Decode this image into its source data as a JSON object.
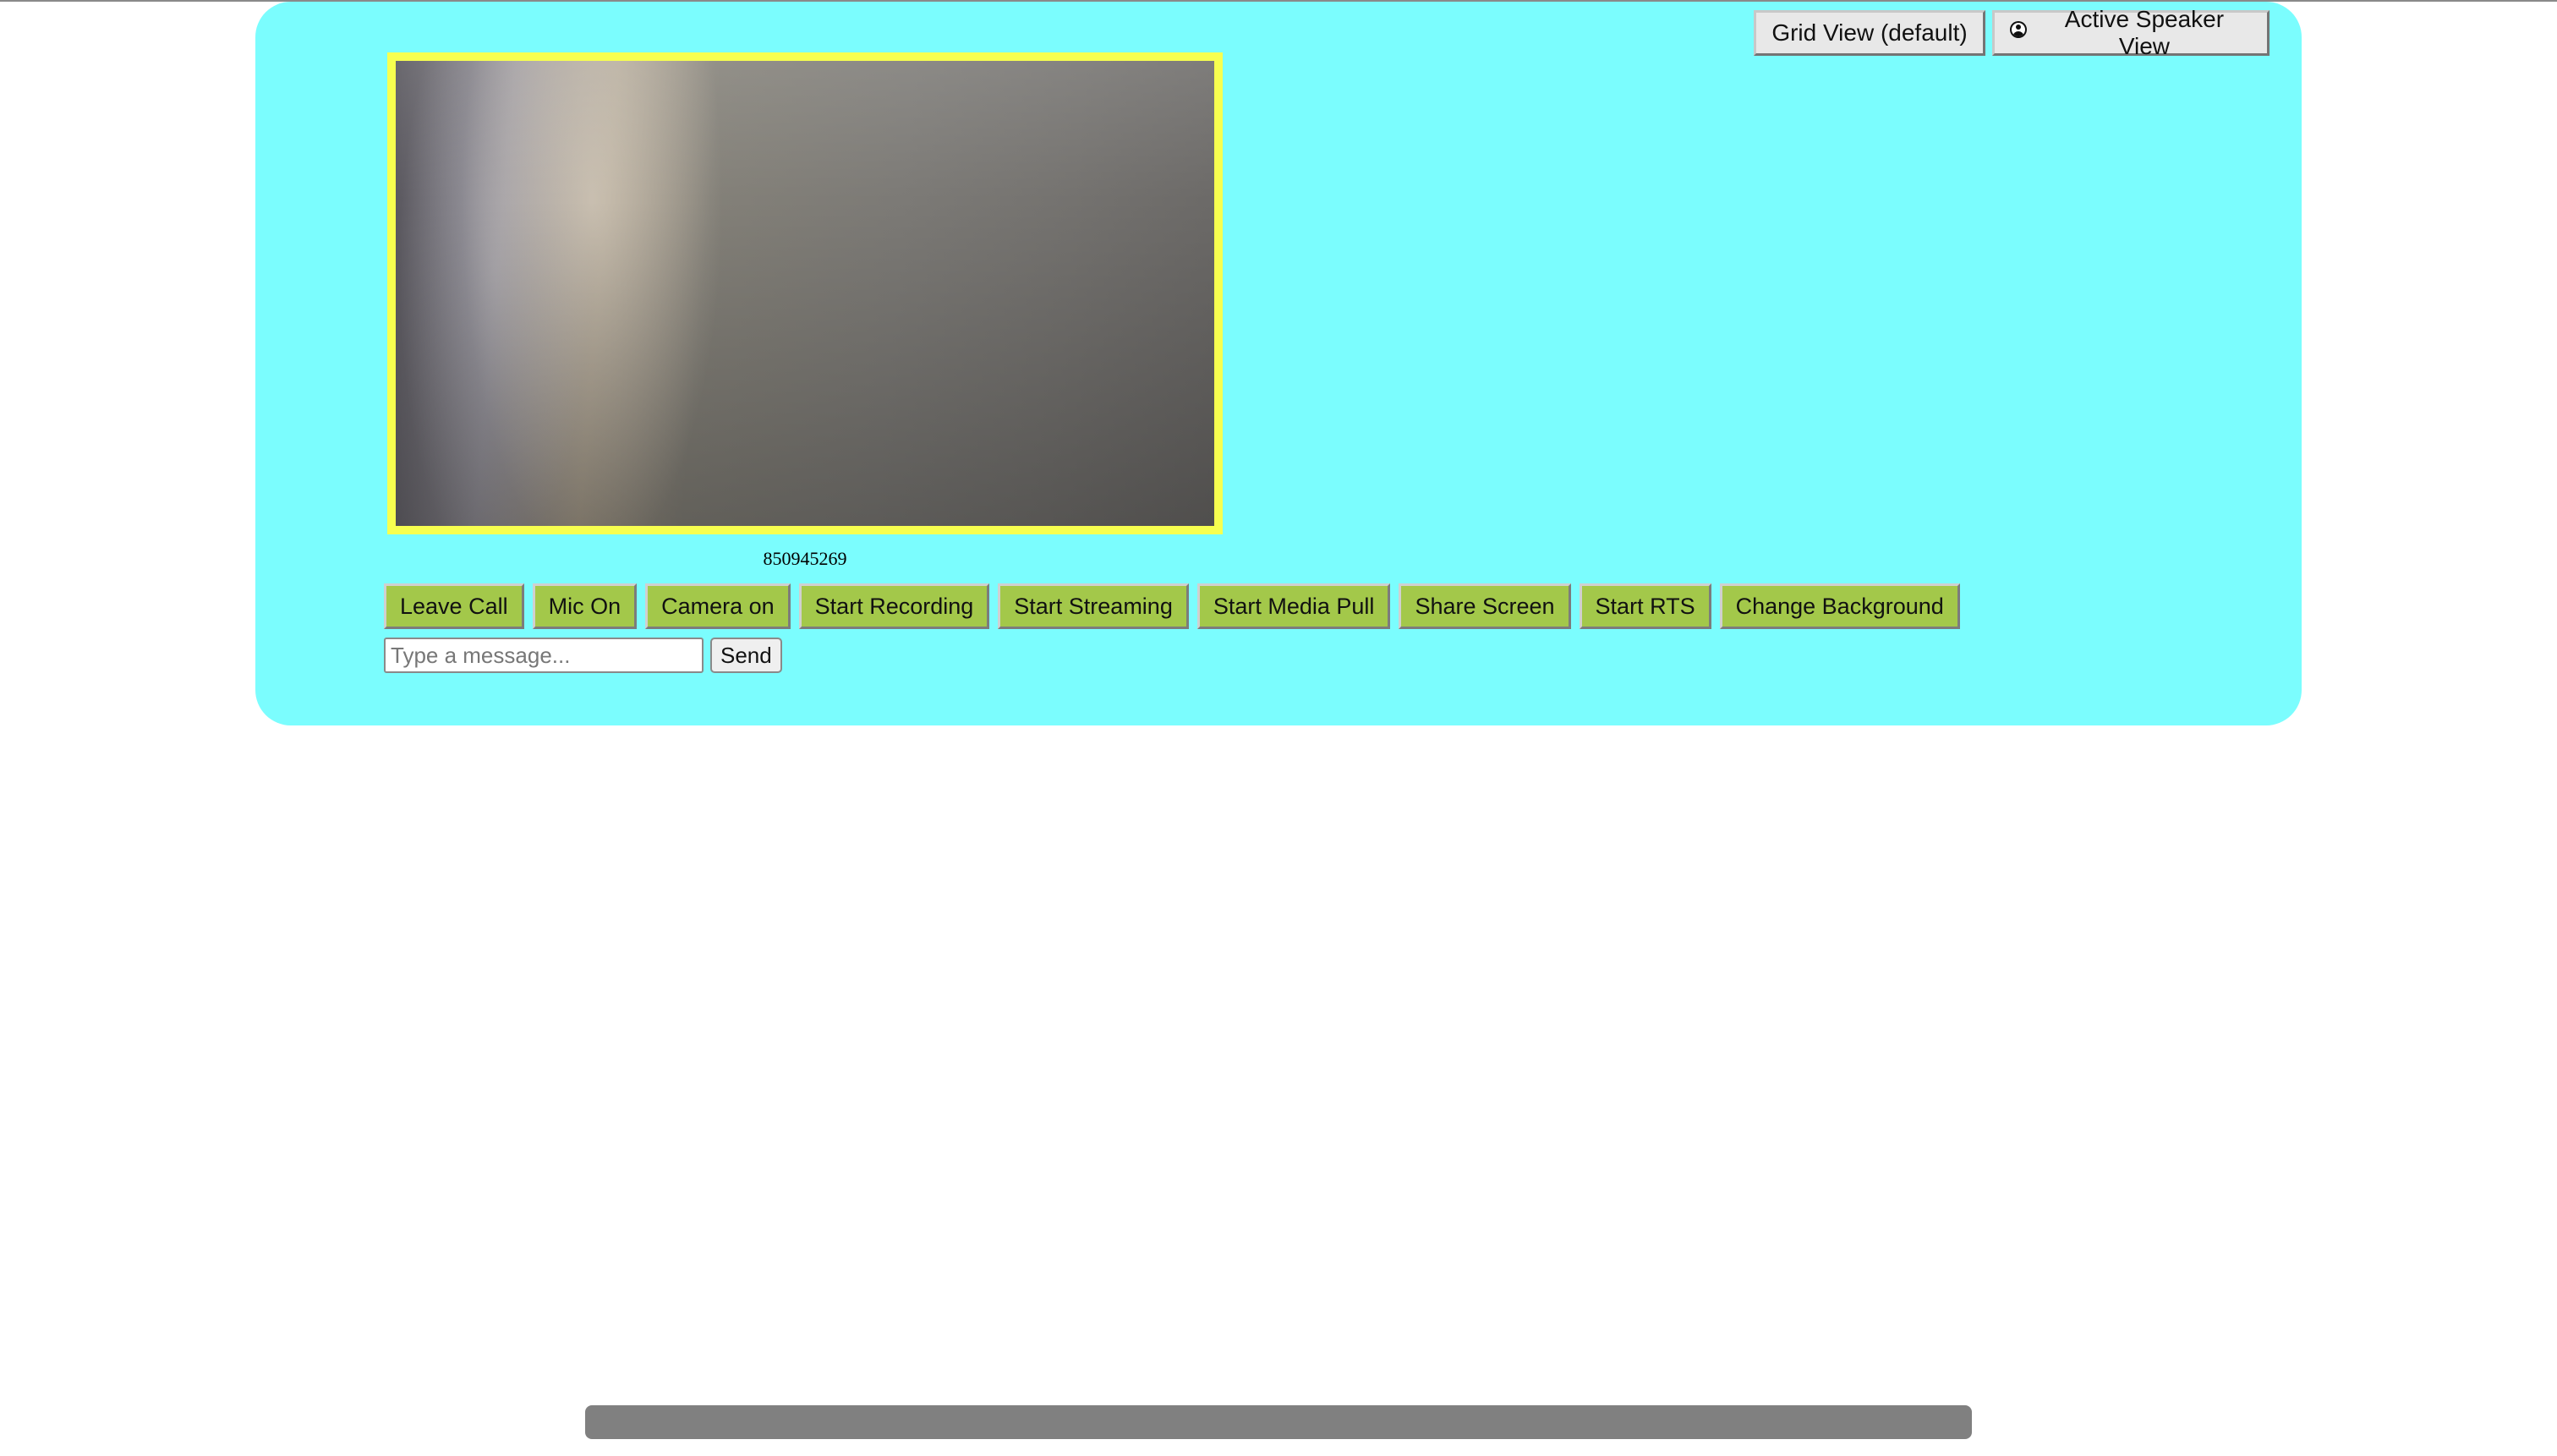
{
  "view_switch": {
    "grid_view_label": "Grid View (default)",
    "active_speaker_label": "Active Speaker View",
    "active_speaker_icon": "user-circle-icon"
  },
  "video": {
    "participant_id": "850945269",
    "border_color": "#f7ff4f"
  },
  "controls": [
    {
      "name": "leave-call-button",
      "label": "Leave Call"
    },
    {
      "name": "mic-toggle-button",
      "label": "Mic On"
    },
    {
      "name": "camera-toggle-button",
      "label": "Camera on"
    },
    {
      "name": "start-recording-button",
      "label": "Start Recording"
    },
    {
      "name": "start-streaming-button",
      "label": "Start Streaming"
    },
    {
      "name": "start-media-pull-button",
      "label": "Start Media Pull"
    },
    {
      "name": "share-screen-button",
      "label": "Share Screen"
    },
    {
      "name": "start-rts-button",
      "label": "Start RTS"
    },
    {
      "name": "change-background-button",
      "label": "Change Background"
    }
  ],
  "chat": {
    "placeholder": "Type a message...",
    "value": "",
    "send_label": "Send"
  },
  "colors": {
    "panel_background": "#7bfdfe",
    "control_button": "#a3c84a"
  }
}
